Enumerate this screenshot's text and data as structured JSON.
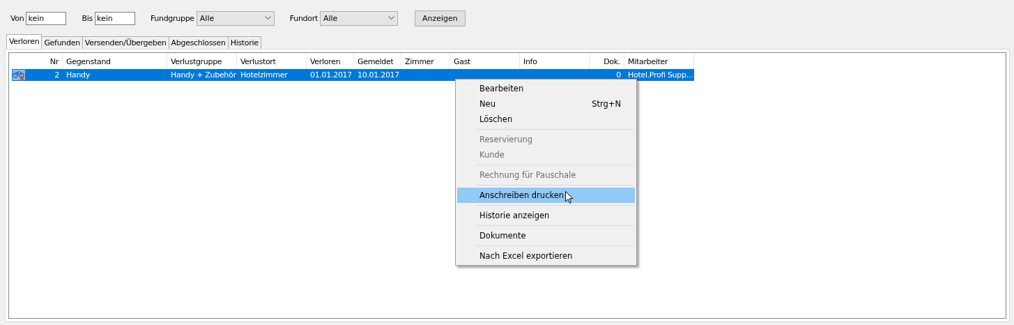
{
  "filters": [
    {
      "kind": "text",
      "label": "Von",
      "value": "kein"
    },
    {
      "kind": "text",
      "label": "Bis",
      "value": "kein"
    },
    {
      "kind": "select",
      "label": "Fundgruppe",
      "value": "Alle"
    },
    {
      "kind": "select",
      "label": "Fundort",
      "value": "Alle"
    }
  ],
  "show_button": "Anzeigen",
  "tabs": [
    {
      "label": "Verloren",
      "selected": true
    },
    {
      "label": "Gefunden",
      "selected": false
    },
    {
      "label": "Versenden/Übergeben",
      "selected": false
    },
    {
      "label": "Abgeschlossen",
      "selected": false
    },
    {
      "label": "Historie",
      "selected": false
    }
  ],
  "table": {
    "columns": [
      "Nr",
      "Gegenstand",
      "Verlustgruppe",
      "Verlustort",
      "Verloren",
      "Gemeldet",
      "Zimmer",
      "Gast",
      "Info",
      "Dok.",
      "Mitarbeiter"
    ],
    "rows": [
      {
        "selected": true,
        "cells": [
          "2",
          "Handy",
          "Handy + Zubehör",
          "Hotelzimmer",
          "01.01.2017",
          "10.01.2017",
          "",
          "",
          "",
          "0",
          "Hotel.Profi Supp..."
        ]
      }
    ]
  },
  "context_menu": [
    {
      "kind": "item",
      "label": "Bearbeiten",
      "disabled": false,
      "selected": false
    },
    {
      "kind": "item",
      "label": "Neu",
      "shortcut": "Strg+N",
      "disabled": false,
      "selected": false
    },
    {
      "kind": "item",
      "label": "Löschen",
      "disabled": false,
      "selected": false
    },
    {
      "kind": "separator"
    },
    {
      "kind": "item",
      "label": "Reservierung",
      "disabled": true,
      "selected": false
    },
    {
      "kind": "item",
      "label": "Kunde",
      "disabled": true,
      "selected": false
    },
    {
      "kind": "separator"
    },
    {
      "kind": "item",
      "label": "Rechnung für Pauschale",
      "disabled": true,
      "selected": false
    },
    {
      "kind": "separator"
    },
    {
      "kind": "item",
      "label": "Anschreiben drucken",
      "disabled": false,
      "selected": true
    },
    {
      "kind": "separator"
    },
    {
      "kind": "item",
      "label": "Historie anzeigen",
      "disabled": false,
      "selected": false
    },
    {
      "kind": "separator"
    },
    {
      "kind": "item",
      "label": "Dokumente",
      "disabled": false,
      "selected": false
    },
    {
      "kind": "separator"
    },
    {
      "kind": "item",
      "label": "Nach Excel exportieren",
      "disabled": false,
      "selected": false
    }
  ]
}
